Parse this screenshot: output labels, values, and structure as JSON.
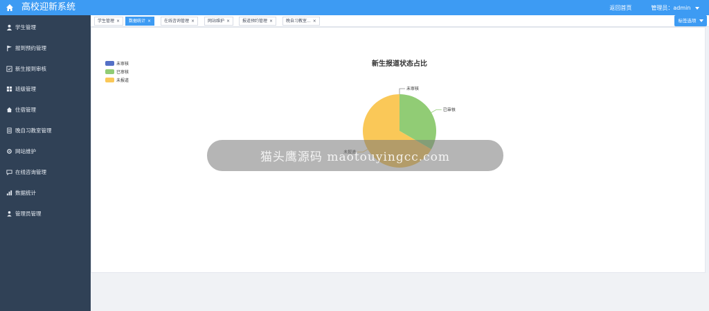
{
  "header": {
    "title": "高校迎新系统",
    "home_link": "返回首页",
    "admin_label": "管理员：admin"
  },
  "sidebar": {
    "items": [
      {
        "label": "学生管理",
        "icon": "user-icon"
      },
      {
        "label": "报到预约管理",
        "icon": "flag-icon"
      },
      {
        "label": "新生报到审核",
        "icon": "check-icon"
      },
      {
        "label": "班级管理",
        "icon": "grid-icon"
      },
      {
        "label": "住宿管理",
        "icon": "home-icon"
      },
      {
        "label": "晚自习教室管理",
        "icon": "document-icon"
      },
      {
        "label": "网站维护",
        "icon": "settings-icon"
      },
      {
        "label": "在线咨询管理",
        "icon": "chat-icon"
      },
      {
        "label": "数据统计",
        "icon": "chart-icon"
      },
      {
        "label": "管理员管理",
        "icon": "people-icon"
      }
    ]
  },
  "tabs": [
    {
      "label": "学生管理",
      "active": false
    },
    {
      "label": "数据统计",
      "active": true
    },
    {
      "label": "在线咨询管理",
      "active": false
    },
    {
      "label": "网站维护",
      "active": false
    },
    {
      "label": "报道预约管理",
      "active": false
    },
    {
      "label": "晚自习教室...",
      "active": false
    }
  ],
  "tab_options_label": "标签选项",
  "watermark_text": "猫头鹰源码 maotouyingcc.com",
  "colors": {
    "header": "#3d9bf3",
    "sidebar": "#304156",
    "unreviewed": "#5470c6",
    "reviewed": "#91cc75",
    "unregistered": "#fac858"
  },
  "chart_data": {
    "type": "pie",
    "title": "新生报道状态占比",
    "legend_position": "top-left",
    "slices": [
      {
        "name": "未审核",
        "value": 0,
        "color": "#5470c6"
      },
      {
        "name": "已审核",
        "value": 1,
        "color": "#91cc75"
      },
      {
        "name": "未报道",
        "value": 2,
        "color": "#fac858"
      }
    ]
  }
}
